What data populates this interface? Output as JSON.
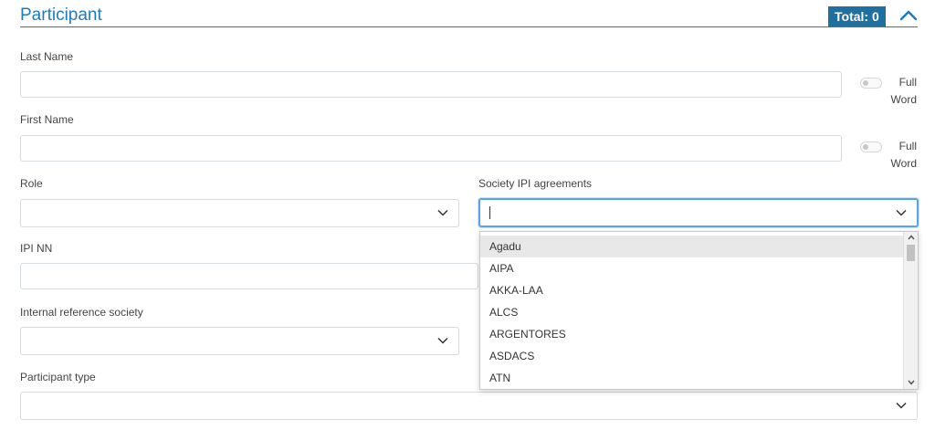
{
  "section": {
    "title": "Participant",
    "total_badge": "Total: 0",
    "accent_color": "#1f7bbf"
  },
  "fields": {
    "last_name": {
      "label": "Last Name",
      "value": "",
      "toggle_label": "Full Word",
      "toggle_on": false
    },
    "first_name": {
      "label": "First Name",
      "value": "",
      "toggle_label": "Full Word",
      "toggle_on": false
    },
    "role": {
      "label": "Role",
      "value": ""
    },
    "society_ipi": {
      "label": "Society IPI agreements",
      "value": ""
    },
    "ipi_nn": {
      "label": "IPI NN",
      "value": ""
    },
    "internal_ref_society": {
      "label": "Internal reference society",
      "value": ""
    },
    "participant_type": {
      "label": "Participant type",
      "value": ""
    }
  },
  "dropdown": {
    "options": [
      "Agadu",
      "AIPA",
      "AKKA-LAA",
      "ALCS",
      "ARGENTORES",
      "ASDACS",
      "ATN"
    ],
    "highlighted_index": 0
  },
  "icons": {
    "collapse": "chevron-up-icon",
    "select": "chevron-down-icon"
  }
}
